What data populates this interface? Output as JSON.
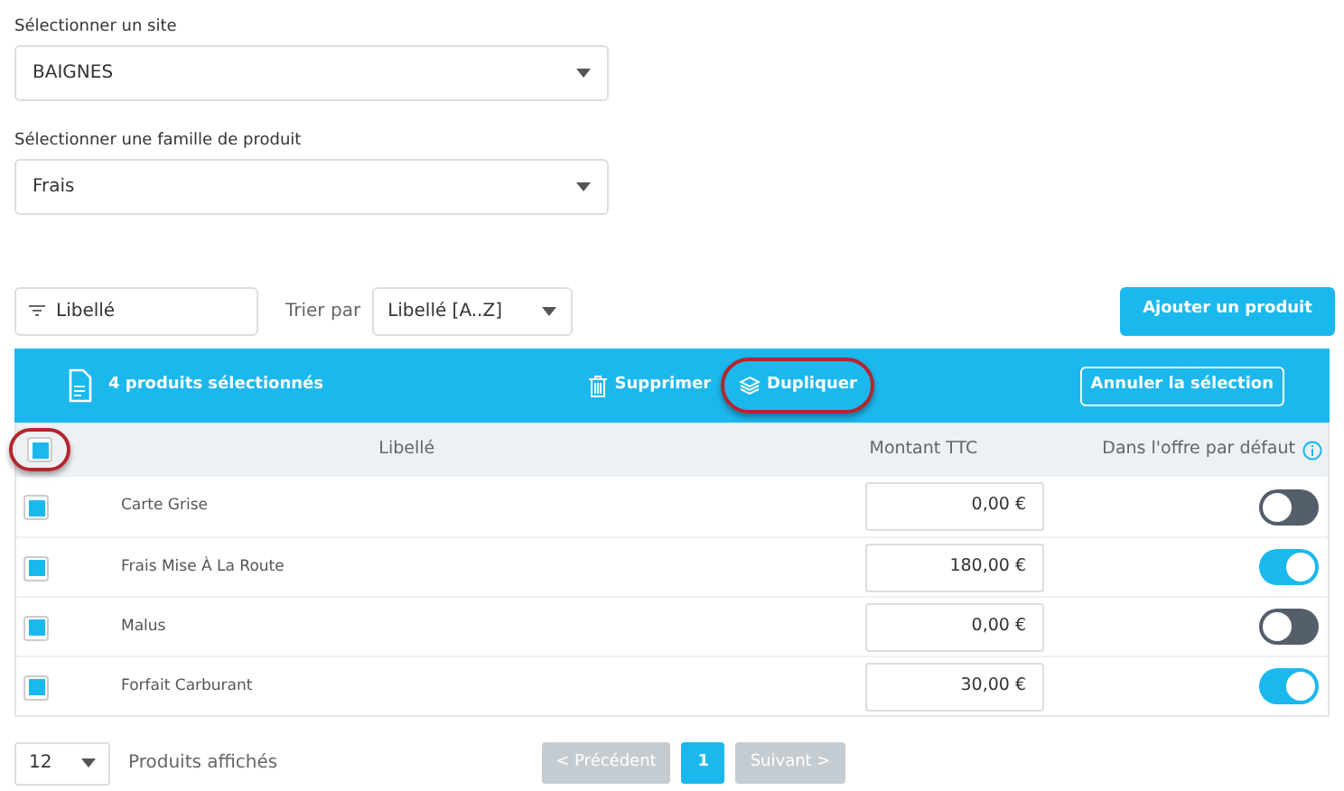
{
  "site_select": {
    "label": "Sélectionner un site",
    "value": "BAIGNES"
  },
  "family_select": {
    "label": "Sélectionner une famille de produit",
    "value": "Frais"
  },
  "toolbar": {
    "filter": {
      "value": "Libellé"
    },
    "sort_label": "Trier par",
    "sort": {
      "value": "Libellé [A..Z]"
    },
    "add_button": "Ajouter un produit"
  },
  "selection_bar": {
    "count": "4 produits sélectionnés",
    "delete": "Supprimer",
    "duplicate": {
      "label": "Dupliquer",
      "highlighted": true
    },
    "cancel": "Annuler la sélection"
  },
  "table": {
    "select_all": {
      "checked": true,
      "highlighted": true
    },
    "columns": [
      "Libellé",
      "Montant TTC",
      "Dans l'offre par défaut"
    ],
    "rows": [
      {
        "checked": true,
        "label": "Carte Grise",
        "amount": "0,00 €",
        "on": false
      },
      {
        "checked": true,
        "label": "Frais Mise À La Route",
        "amount": "180,00 €",
        "on": true
      },
      {
        "checked": true,
        "label": "Malus",
        "amount": "0,00 €",
        "on": false
      },
      {
        "checked": true,
        "label": "Forfait Carburant",
        "amount": "30,00 €",
        "on": true
      }
    ]
  },
  "footer": {
    "page_size": "12",
    "page_size_label": "Produits affichés",
    "prev": "< Précédent",
    "pages": [
      {
        "label": "1",
        "selected": true
      }
    ],
    "next": "Suivant >"
  }
}
